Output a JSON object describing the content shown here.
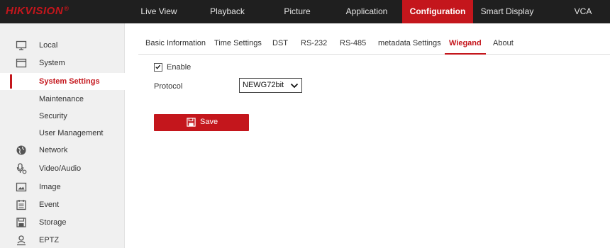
{
  "brand": {
    "name": "HIKVISION",
    "reg_mark": "®"
  },
  "nav": {
    "items": [
      {
        "label": "Live View"
      },
      {
        "label": "Playback"
      },
      {
        "label": "Picture"
      },
      {
        "label": "Application"
      },
      {
        "label": "Configuration",
        "active": true
      },
      {
        "label": "Smart Display"
      },
      {
        "label": "VCA"
      }
    ]
  },
  "sidebar": {
    "local": {
      "label": "Local",
      "icon": "monitor-icon"
    },
    "system": {
      "label": "System",
      "icon": "system-icon"
    },
    "system_children": [
      {
        "label": "System Settings",
        "active": true
      },
      {
        "label": "Maintenance"
      },
      {
        "label": "Security"
      },
      {
        "label": "User Management"
      }
    ],
    "network": {
      "label": "Network",
      "icon": "globe-icon"
    },
    "video_audio": {
      "label": "Video/Audio",
      "icon": "video-audio-icon"
    },
    "image": {
      "label": "Image",
      "icon": "image-icon"
    },
    "event": {
      "label": "Event",
      "icon": "calendar-icon"
    },
    "storage": {
      "label": "Storage",
      "icon": "storage-icon"
    },
    "eptz": {
      "label": "EPTZ",
      "icon": "person-icon"
    }
  },
  "tabs": [
    {
      "label": "Basic Information"
    },
    {
      "label": "Time Settings"
    },
    {
      "label": "DST"
    },
    {
      "label": "RS-232"
    },
    {
      "label": "RS-485"
    },
    {
      "label": "metadata Settings"
    },
    {
      "label": "Wiegand",
      "active": true
    },
    {
      "label": "About"
    }
  ],
  "form": {
    "enable_label": "Enable",
    "enable_checked": true,
    "protocol_label": "Protocol",
    "protocol_value": "NEWG72bit",
    "save_label": "Save"
  },
  "colors": {
    "accent": "#c4161c",
    "topbar": "#1f1f1f",
    "sidebar": "#f0f0f0"
  }
}
